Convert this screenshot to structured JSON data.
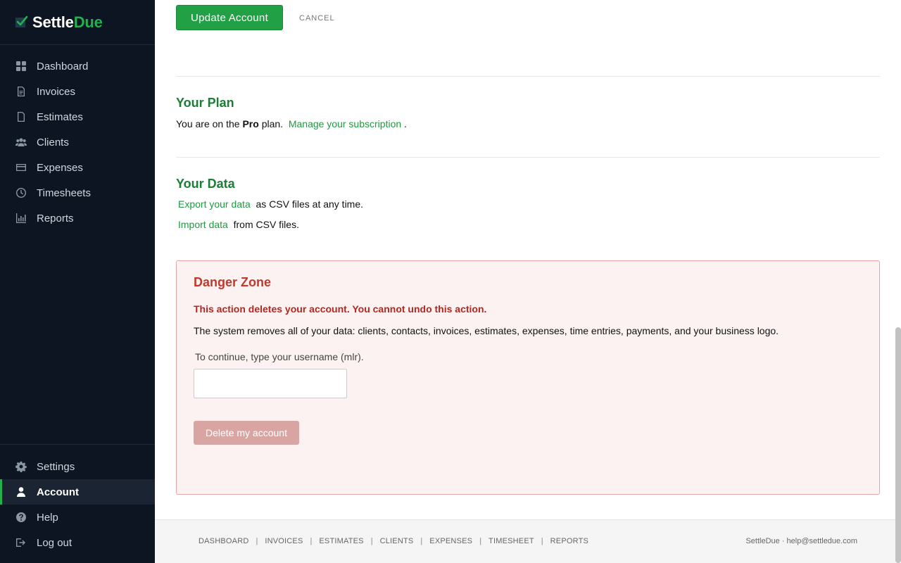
{
  "brand": {
    "name_part1": "Settle",
    "name_part2": "Due",
    "accent_color": "#22b14c"
  },
  "sidebar": {
    "items": [
      {
        "label": "Dashboard",
        "icon": "dashboard-icon"
      },
      {
        "label": "Invoices",
        "icon": "invoice-icon"
      },
      {
        "label": "Estimates",
        "icon": "estimate-icon"
      },
      {
        "label": "Clients",
        "icon": "clients-icon"
      },
      {
        "label": "Expenses",
        "icon": "credit-card-icon"
      },
      {
        "label": "Timesheets",
        "icon": "clock-icon"
      },
      {
        "label": "Reports",
        "icon": "bar-chart-icon"
      }
    ],
    "bottom_items": [
      {
        "label": "Settings",
        "icon": "gear-icon"
      },
      {
        "label": "Account",
        "icon": "user-icon",
        "active": true
      },
      {
        "label": "Help",
        "icon": "help-icon"
      },
      {
        "label": "Log out",
        "icon": "logout-icon"
      }
    ]
  },
  "actions": {
    "update_label": "Update Account",
    "cancel_label": "CANCEL"
  },
  "plan": {
    "title": "Your Plan",
    "prefix": "You are on the",
    "plan_name": "Pro",
    "suffix": "plan.",
    "link": "Manage your subscription",
    "end": "."
  },
  "data_section": {
    "title": "Your Data",
    "export_link": "Export your data",
    "export_text": "as CSV files at any time.",
    "import_link": "Import data",
    "import_text": "from CSV files."
  },
  "danger": {
    "title": "Danger Zone",
    "warning": "This action deletes your account. You cannot undo this action.",
    "description": "The system removes all of your data: clients, contacts, invoices, estimates, expenses, time entries, payments, and your business logo.",
    "label": "To continue, type your username (mlr).",
    "input_value": "",
    "delete_label": "Delete my account"
  },
  "footer": {
    "links": [
      "DASHBOARD",
      "INVOICES",
      "ESTIMATES",
      "CLIENTS",
      "EXPENSES",
      "TIMESHEET",
      "REPORTS"
    ],
    "right": "SettleDue · help@settledue.com"
  }
}
